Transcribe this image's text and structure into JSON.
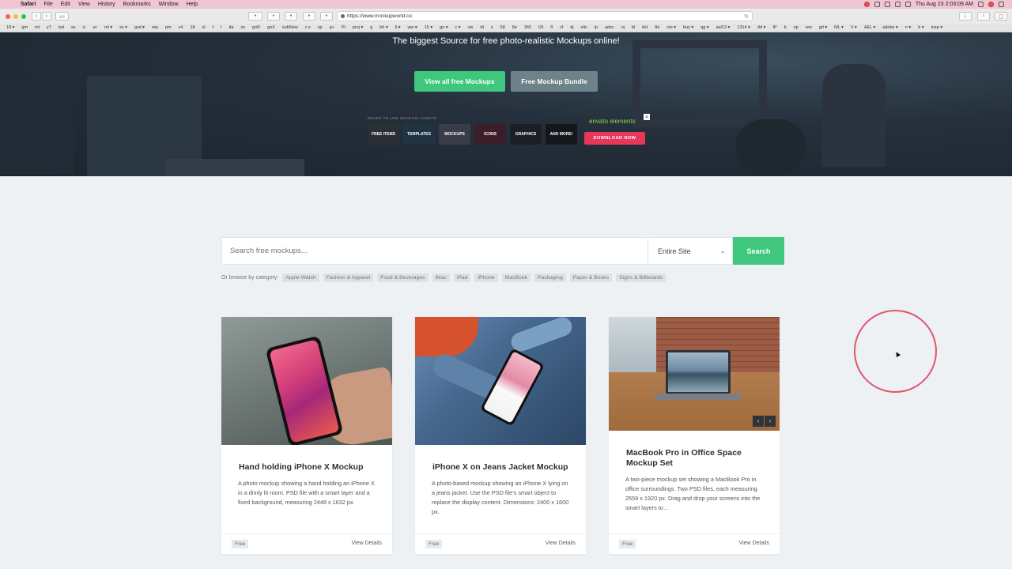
{
  "menubar": {
    "app": "Safari",
    "items": [
      "File",
      "Edit",
      "View",
      "History",
      "Bookmarks",
      "Window",
      "Help"
    ],
    "clock": "Thu Aug 23  2:03:09 AM"
  },
  "browser": {
    "url": "https://www.mockupworld.co",
    "bookmarks": [
      "18 ▾",
      "gm",
      "ml",
      "yT",
      "twt",
      "ss",
      "ic",
      "sc",
      "ml ▾",
      "ss ▾",
      "gsd ▾",
      "ww",
      "pm",
      "v4",
      "18",
      "sl",
      "f",
      "l",
      "da",
      "ss",
      "goR",
      "goX",
      "subNew",
      "c.s",
      "sp",
      "g+",
      "Pl",
      "proj ▾",
      "g",
      "bh ▾",
      "ll ▾",
      "ww ▾",
      "15 ▾",
      "go ▾",
      "c ▾",
      "vis",
      "td",
      "s",
      "68",
      "8e",
      "365",
      "t2t",
      "fl",
      "cf",
      "dj",
      "elic",
      "ip",
      "adsc",
      "nj",
      "bl",
      "bH",
      "8e",
      "cte ▾",
      "buy ▾",
      "qg ▾",
      "ael13 ▾",
      "1314 ▾",
      "dd ▾",
      "IP",
      "b",
      "op",
      "ww",
      "gd ▾",
      "ML ▾",
      "V ▾",
      "AEL ▾",
      "adobe ▾",
      "n ▾",
      "b ▾",
      "insp ▾"
    ]
  },
  "hero": {
    "tagline": "The biggest Source for free photo-realistic Mockups online!",
    "btn_all": "View all free Mockups",
    "btn_bundle": "Free Mockup Bundle",
    "ad": {
      "label": "READY TO USE GRAPHIC ASSETS",
      "tiles": [
        "FREE ITEMS",
        "TEMPLATES",
        "MOCKUPS",
        "ICONS",
        "GRAPHICS",
        "AND MORE!"
      ],
      "brand": "envato elements",
      "close": "✕",
      "cta": "DOWNLOAD NOW"
    }
  },
  "search": {
    "placeholder": "Search free mockups...",
    "scope": "Entire Site",
    "button": "Search",
    "browse_label": "Or browse by category:",
    "categories": [
      "Apple Watch",
      "Fashion & Apparel",
      "Food & Beverages",
      "iMac",
      "iPad",
      "iPhone",
      "MacBook",
      "Packaging",
      "Paper & Books",
      "Signs & Billboards"
    ]
  },
  "cards": [
    {
      "title": "Hand holding iPhone X Mockup",
      "desc": "A photo mockup showing a hand holding an iPhone X in a dimly lit room. PSD file with a smart layer and a fixed background, measuring 2448 x 1632 px.",
      "badge": "Free",
      "details": "View Details"
    },
    {
      "title": "iPhone X on Jeans Jacket Mockup",
      "desc": "A photo-based mockup showing an iPhone X lying on a jeans jacket. Use the PSD file's smart object to replace the display content. Dimensions: 2400 x 1600 px.",
      "badge": "Free",
      "details": "View Details"
    },
    {
      "title": "MacBook Pro in Office Space Mockup Set",
      "desc": "A two-piece mockup set showing a MacBook Pro in office surroundings. Two PSD files, each measuring 2559 x 1920 px. Drag and drop your screens into the smart layers to…",
      "badge": "Free",
      "details": "View Details",
      "prev": "‹",
      "next": "›"
    }
  ],
  "colors": {
    "accent_green": "#3ec77d",
    "secondary_gray": "#6d8289",
    "ad_pink": "#e8385a",
    "cursor_ring": "#e0556f"
  }
}
